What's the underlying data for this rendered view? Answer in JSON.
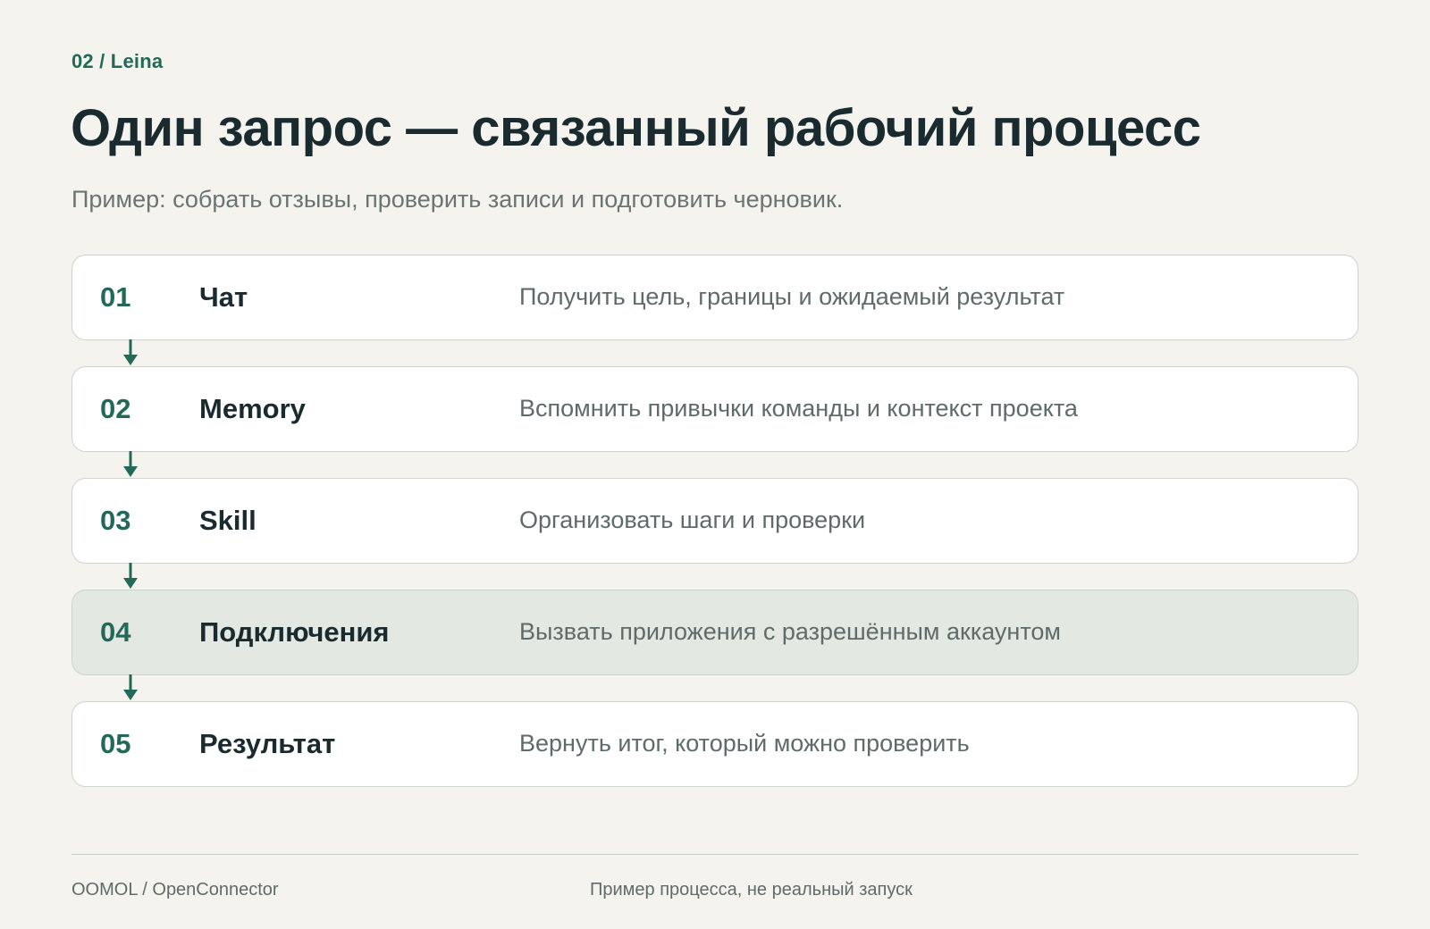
{
  "header": {
    "eyebrow": "02 / Leina",
    "title": "Один запрос — связанный рабочий процесс",
    "subtitle": "Пример: собрать отзывы, проверить записи и подготовить черновик."
  },
  "steps": [
    {
      "num": "01",
      "name": "Чат",
      "desc": "Получить цель, границы и ожидаемый результат",
      "highlighted": false
    },
    {
      "num": "02",
      "name": "Memory",
      "desc": "Вспомнить привычки команды и контекст проекта",
      "highlighted": false
    },
    {
      "num": "03",
      "name": "Skill",
      "desc": "Организовать шаги и проверки",
      "highlighted": false
    },
    {
      "num": "04",
      "name": "Подключения",
      "desc": "Вызвать приложения с разрешённым аккаунтом",
      "highlighted": true
    },
    {
      "num": "05",
      "name": "Результат",
      "desc": "Вернуть итог, который можно проверить",
      "highlighted": false
    }
  ],
  "footer": {
    "left": "OOMOL / OpenConnector",
    "center": "Пример процесса, не реальный запуск"
  },
  "colors": {
    "background": "#f4f3ed",
    "accent": "#22695a",
    "heading": "#1a2b2f",
    "muted": "#5f6b6a",
    "card": "#ffffff",
    "card_highlight": "#e3e8e2",
    "border": "#cdd3ce"
  },
  "icons": {
    "connector": "arrow-down-icon"
  }
}
